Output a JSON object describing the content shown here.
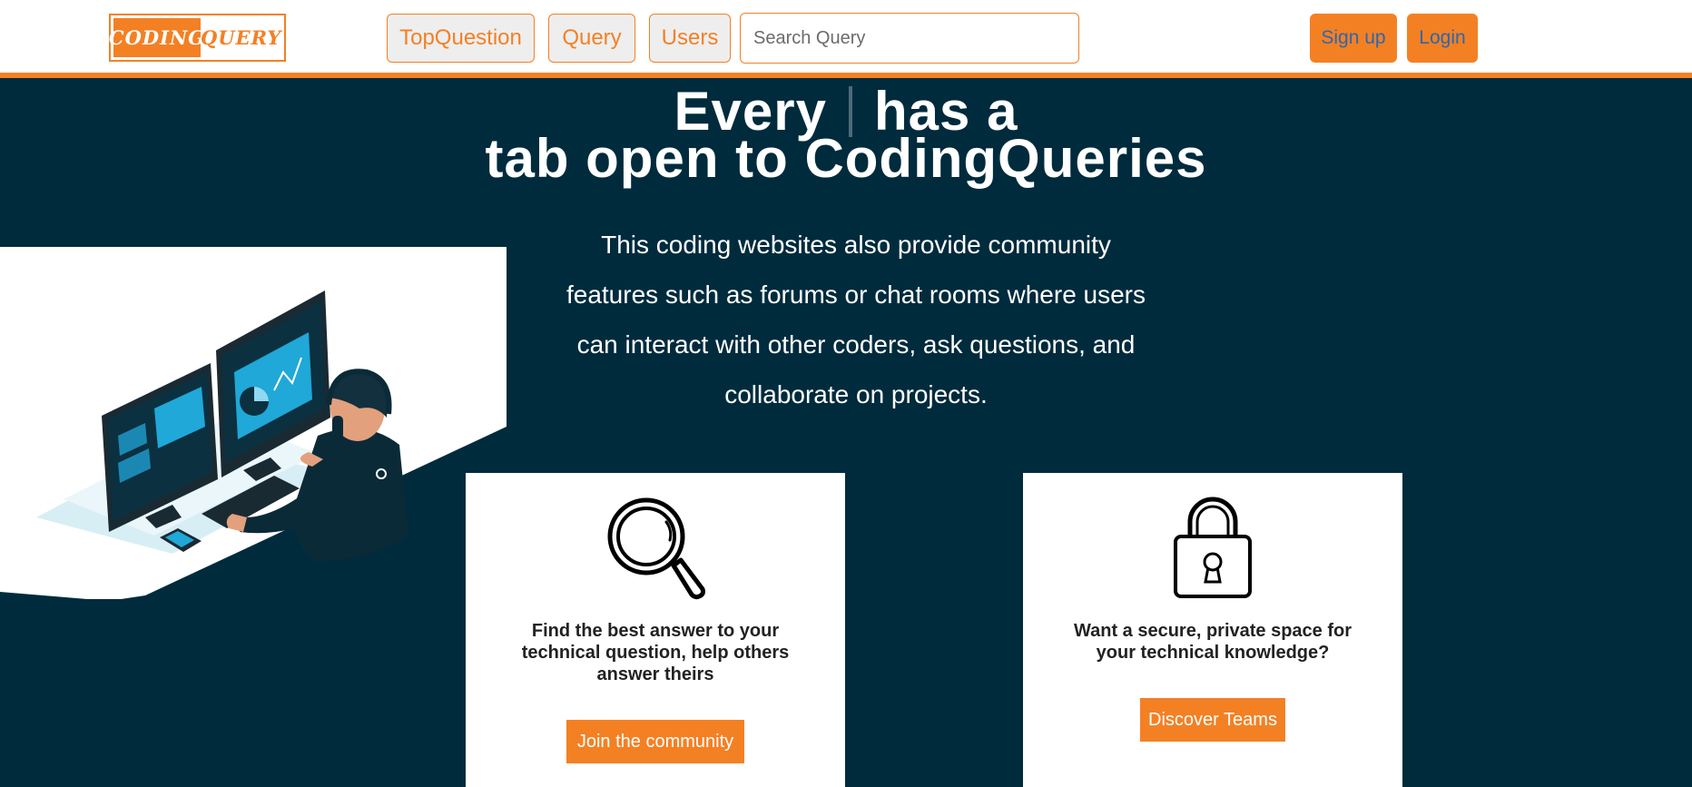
{
  "brand": {
    "logo_left": "CODING",
    "logo_right": "QUERY",
    "accent_color": "#f48024",
    "hero_bg_color": "#002b3d"
  },
  "navbar": {
    "links": [
      "TopQuestion",
      "Query",
      "Users"
    ],
    "search_placeholder": "Search Query",
    "signup_label": "Sign up",
    "login_label": "Login"
  },
  "hero": {
    "line1_left": "Every",
    "line1_right": "has a",
    "line2": "tab open to CodingQueries",
    "description": "This coding websites also provide community features such as forums or chat rooms where users can interact with other coders, ask questions, and collaborate on projects."
  },
  "cards": [
    {
      "icon": "magnifier-icon",
      "text": "Find the best answer to your technical question, help others answer theirs",
      "button_label": "Join the community"
    },
    {
      "icon": "padlock-icon",
      "text": "Want a secure, private space for your technical knowledge?",
      "button_label": "Discover Teams"
    }
  ]
}
